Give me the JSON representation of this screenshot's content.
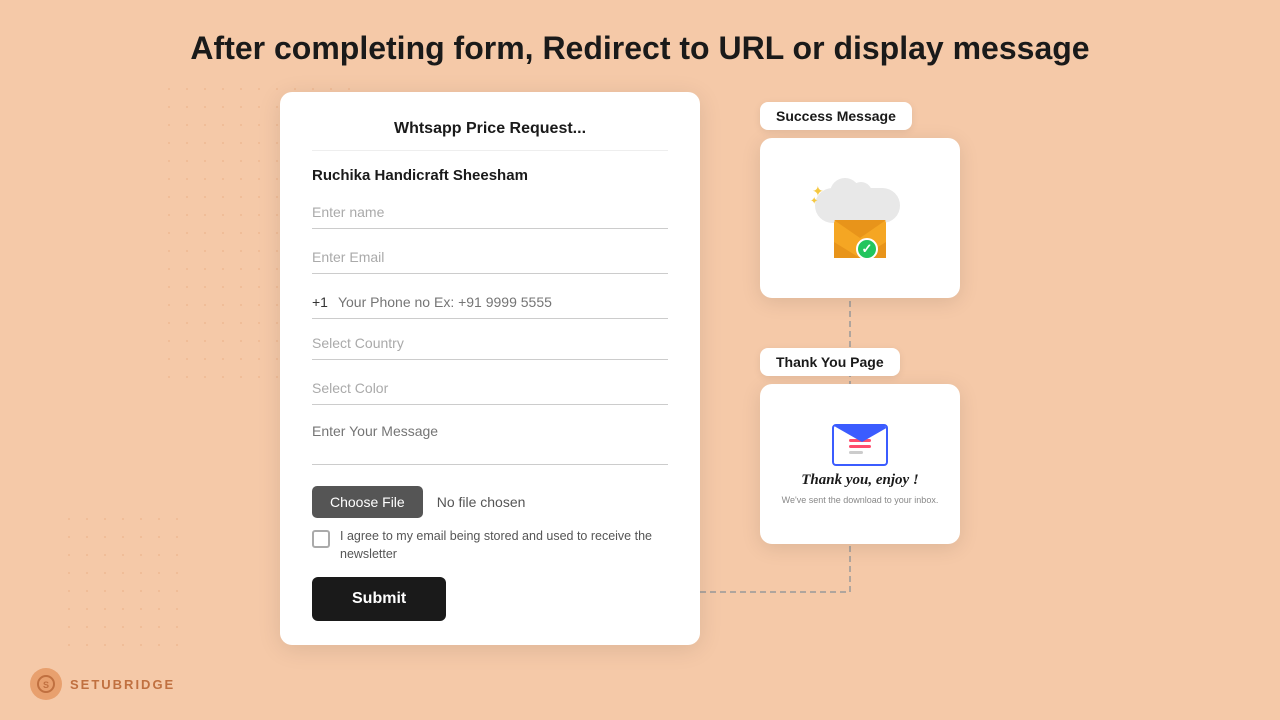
{
  "page": {
    "title": "After completing form, Redirect to URL or display message"
  },
  "form": {
    "title": "Whtsapp Price Request...",
    "subtitle": "Ruchika Handicraft Sheesham",
    "fields": {
      "name_placeholder": "Enter name",
      "email_placeholder": "Enter Email",
      "phone_prefix": "+1",
      "phone_placeholder": "Your Phone no Ex: +91 9999 5555",
      "country_placeholder": "Select Country",
      "color_placeholder": "Select Color",
      "message_placeholder": "Enter Your Message"
    },
    "file": {
      "button_label": "Choose File",
      "no_file_text": "No file chosen"
    },
    "checkbox_label": "I agree to my email being stored and used to receive the newsletter",
    "submit_label": "Submit"
  },
  "right_panel": {
    "success_label": "Success Message",
    "thankyou_label": "Thank You Page",
    "thankyou_text": "Thank you, enjoy !",
    "thankyou_sub": "We've sent the download to your inbox."
  },
  "logo": {
    "text": "SETUBRIDGE"
  }
}
